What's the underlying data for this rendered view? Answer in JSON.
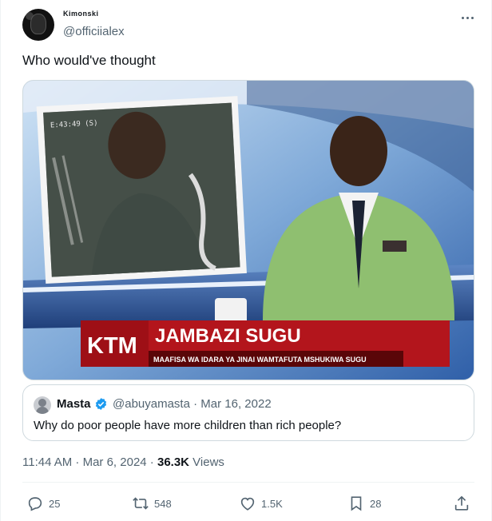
{
  "author": {
    "display_name": "Kimonski",
    "handle": "@officiialex"
  },
  "tweet": {
    "text": "Who would've thought"
  },
  "media": {
    "channel_logo": "KTM",
    "headline": "JAMBAZI SUGU",
    "ticker": "MAAFISA WA IDARA YA JINAI WAMTAFUTA MSHUKIWA SUGU",
    "inset_timestamp": "E:43:49 (S)"
  },
  "quote": {
    "name": "Masta",
    "handle_and_date": "@abuyamasta · Mar 16, 2022",
    "text": "Why do poor people have more children than rich people?"
  },
  "meta": {
    "time_date": "11:44 AM · Mar 6, 2024 · ",
    "views_count": "36.3K",
    "views_label": " Views"
  },
  "actions": {
    "replies": "25",
    "reposts": "548",
    "likes": "1.5K",
    "bookmarks": "28"
  },
  "colors": {
    "verified": "#1d9bf0",
    "muted": "#536471",
    "banner_red": "#b3151c"
  },
  "icons": [
    "more-icon",
    "verified-icon",
    "reply-icon",
    "repost-icon",
    "like-icon",
    "bookmark-icon",
    "share-icon"
  ]
}
